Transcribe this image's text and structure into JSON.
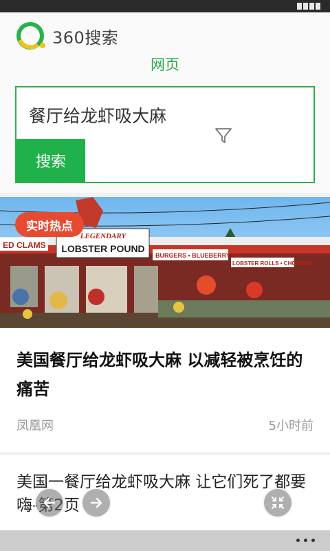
{
  "app": {
    "logo_text": "360搜索",
    "tab_label": "网页"
  },
  "search": {
    "query": "餐厅给龙虾吸大麻",
    "button_label": "搜索"
  },
  "results": [
    {
      "badge": "实时热点",
      "title": "美国餐厅给龙虾吸大麻 以减轻被烹饪的痛苦",
      "source": "凤凰网",
      "time": "5小时前"
    },
    {
      "title": "美国一餐厅给龙虾吸大麻 让它们死了都要嗨-第2页"
    }
  ],
  "photo_signs": {
    "sign1": "ED CLAMS",
    "sign2": "LEGENDARY",
    "sign3": "LOBSTER POUND",
    "sign4": "BURGERS • BLUEBERRY PIE",
    "sign5": "LOBSTER ROLLS • CHOWDER"
  },
  "colors": {
    "brand_green": "#20b14a",
    "badge_red": "#e64b32"
  },
  "icons": [
    "logo-ring-icon",
    "filter-icon",
    "back-arrow-icon",
    "forward-arrow-icon",
    "exit-fullscreen-icon",
    "more-dots-icon"
  ]
}
